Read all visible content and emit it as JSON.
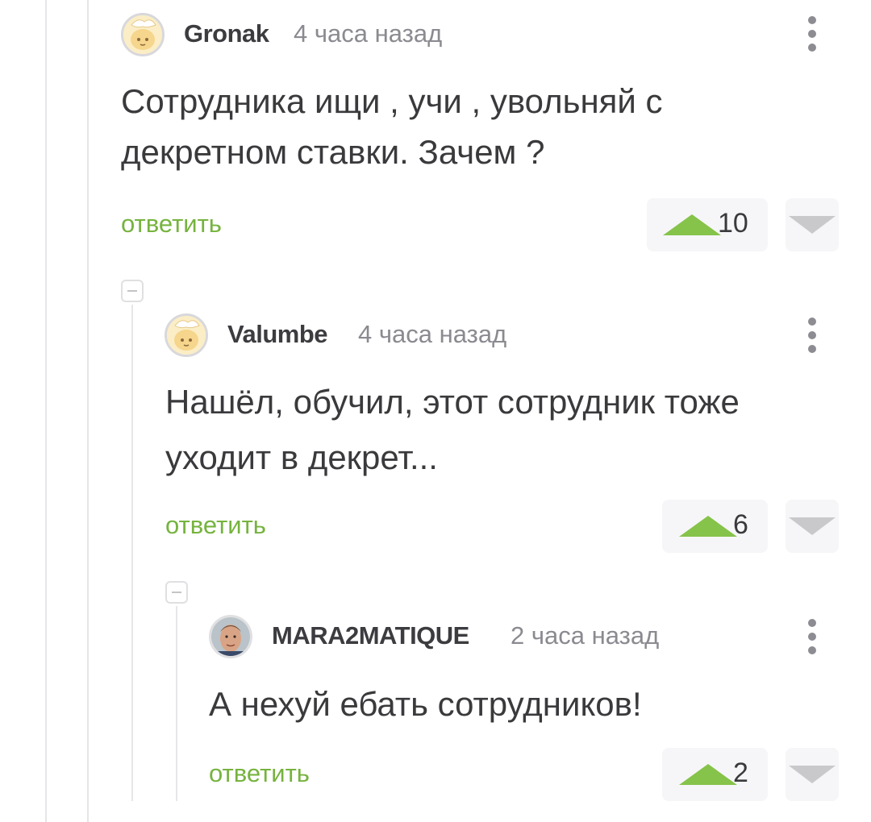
{
  "colors": {
    "accent_green": "#76b33e",
    "vote_green": "#86c34a",
    "muted": "#8a8a90",
    "text": "#3a3a3d"
  },
  "comments": [
    {
      "username": "Gronak",
      "time": "4 часа назад",
      "avatar_icon": "cat-avatar-icon",
      "lines": [
        "Сотрудника ищи , учи , увольняй с",
        "декретном ставки. Зачем ?"
      ],
      "reply_label": "ответить",
      "rating": "10"
    },
    {
      "username": "Valumbe",
      "time": "4 часа назад",
      "avatar_icon": "cat-avatar-icon",
      "lines": [
        "Нашёл, обучил, этот сотрудник тоже",
        "уходит в декрет..."
      ],
      "reply_label": "ответить",
      "rating": "6"
    },
    {
      "username": "MARA2MATIQUE",
      "time": "2 часа назад",
      "avatar_icon": "photo-avatar-icon",
      "lines": [
        "А нехуй ебать сотрудников!"
      ],
      "reply_label": "ответить",
      "rating": "2"
    }
  ]
}
